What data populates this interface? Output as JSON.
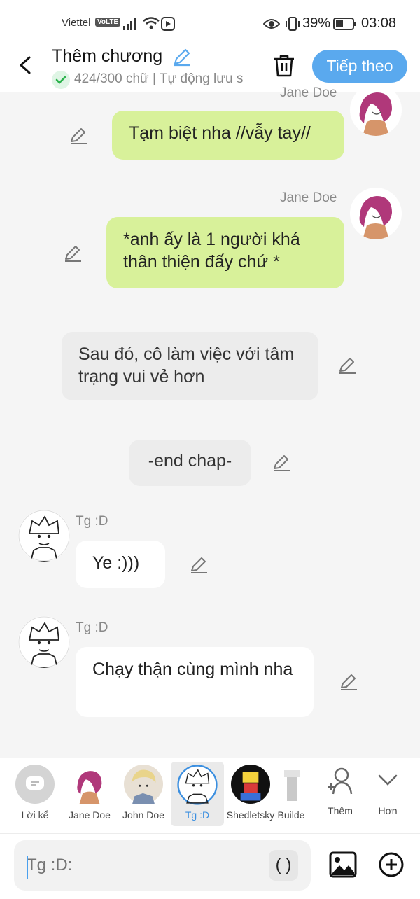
{
  "status_bar": {
    "carrier": "Viettel",
    "network_badge": "VoLTE",
    "battery": "39%",
    "time": "03:08"
  },
  "header": {
    "title": "Thêm chương",
    "subtitle": "424/300 chữ | Tự động lưu s",
    "next_label": "Tiếp theo",
    "icons": [
      "back-arrow-icon",
      "pencil-icon",
      "check-icon",
      "trash-icon"
    ]
  },
  "messages": [
    {
      "speaker": "Jane Doe",
      "text": "Tạm biệt nha //vẫy tay//",
      "side": "right",
      "style": "green"
    },
    {
      "speaker": "Jane Doe",
      "text": "*anh ấy là 1 người khá thân thiện đấy chứ *",
      "side": "right",
      "style": "green"
    },
    {
      "speaker": "",
      "text": "Sau đó, cô làm việc với tâm trạng vui vẻ hơn",
      "side": "narration",
      "style": "gray"
    },
    {
      "speaker": "",
      "text": "-end chap-",
      "side": "center",
      "style": "gray"
    },
    {
      "speaker": "Tg :D",
      "text": "Ye :)))",
      "side": "left",
      "style": "white"
    },
    {
      "speaker": "Tg :D",
      "text": "Chạy thận cùng mình nha",
      "side": "left",
      "style": "white"
    }
  ],
  "characters": [
    {
      "label": "Lời kể",
      "icon": "narration-icon"
    },
    {
      "label": "Jane Doe"
    },
    {
      "label": "John Doe"
    },
    {
      "label": "Tg :D",
      "selected": true
    },
    {
      "label": "Shedletsky"
    },
    {
      "label": "Builde"
    },
    {
      "label": "Thêm",
      "icon": "add-person-icon"
    },
    {
      "label": "Hơn",
      "icon": "chevron-down-icon"
    }
  ],
  "input": {
    "placeholder": "Tg :D:",
    "paren_label": "( )",
    "icons": [
      "image-icon",
      "plus-circle-icon"
    ]
  },
  "colors": {
    "accent": "#5aa9ee",
    "green_bubble": "#d8f19a",
    "gray_bubble": "#ececec",
    "selected_text": "#3b8fe0"
  }
}
